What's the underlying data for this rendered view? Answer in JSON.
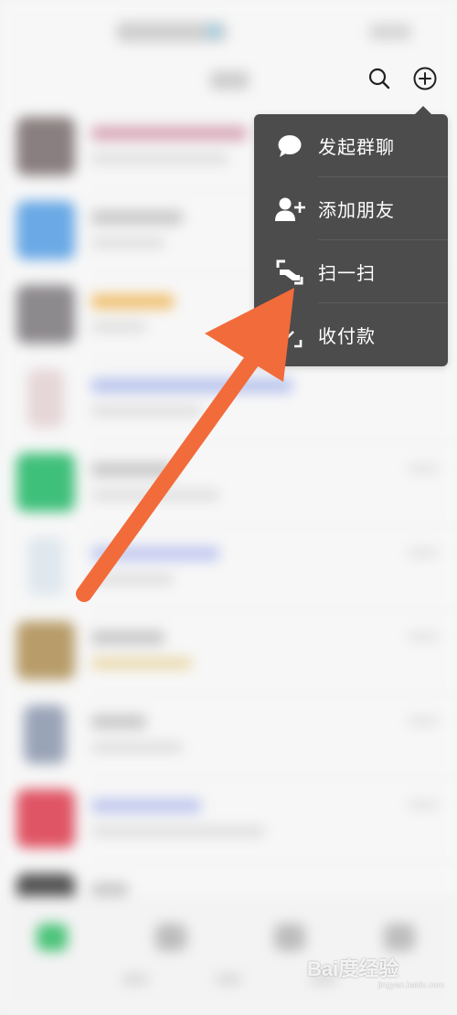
{
  "header": {
    "search_icon": "search-icon",
    "add_icon": "plus-circle-icon"
  },
  "menu": {
    "items": [
      {
        "label": "发起群聊",
        "icon": "chat-bubble-icon"
      },
      {
        "label": "添加朋友",
        "icon": "add-friend-icon"
      },
      {
        "label": "扫一扫",
        "icon": "scan-icon"
      },
      {
        "label": "收付款",
        "icon": "payment-icon"
      }
    ]
  },
  "annotation": {
    "arrow_color": "#f26b3a"
  },
  "watermark": {
    "text": "Bai度经验",
    "url": "jingyan.baidu.com"
  },
  "colors": {
    "menu_bg": "#4c4c4c",
    "menu_text": "#ffffff"
  }
}
